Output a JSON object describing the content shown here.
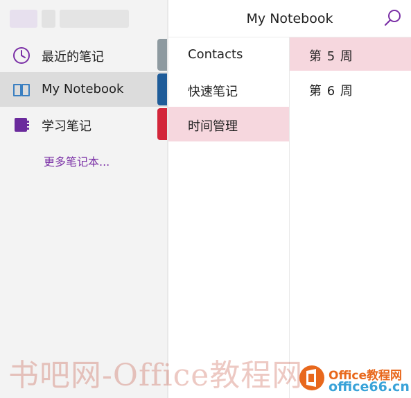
{
  "colors": {
    "accent_purple": "#7a2fa6",
    "tab_recent": "#8e9aa0",
    "tab_mynotebook": "#1f5c99",
    "tab_study": "#d3263a",
    "selected_section_bg": "#f6d7de"
  },
  "header": {
    "title": "My Notebook",
    "search_icon": "search-icon"
  },
  "notebooks": {
    "items": [
      {
        "label": "最近的笔记",
        "icon": "clock-icon"
      },
      {
        "label": "My Notebook",
        "icon": "notebook-icon"
      },
      {
        "label": "学习笔记",
        "icon": "notebook-purple-icon"
      }
    ],
    "more_link": "更多笔记本..."
  },
  "sections": {
    "items": [
      {
        "label": "Contacts"
      },
      {
        "label": "快速笔记"
      },
      {
        "label": "时间管理"
      }
    ]
  },
  "pages": {
    "items": [
      {
        "label": "第 5 周"
      },
      {
        "label": "第 6 周"
      }
    ]
  },
  "watermark": {
    "text": "书吧网-Office教程网",
    "brand": "Office教程网",
    "url": "office66.cn"
  }
}
